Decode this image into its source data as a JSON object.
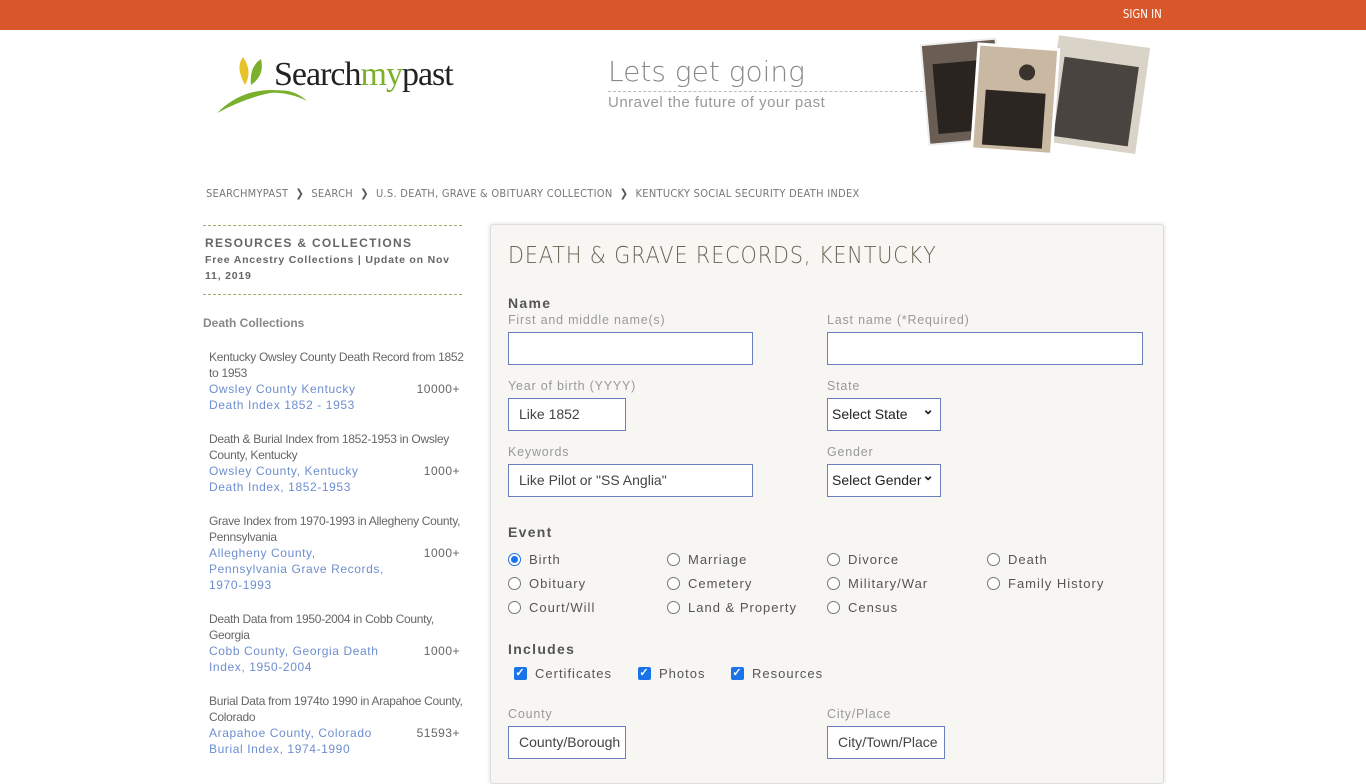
{
  "topbar": {
    "sign_in": "SIGN IN",
    "color": "#d9552a"
  },
  "header": {
    "logo_text_a": "Search",
    "logo_text_b": "my",
    "logo_text_c": "past",
    "tagline": "Lets get going",
    "subtagline": "Unravel the future of your past"
  },
  "breadcrumb": [
    "SEARCHMYPAST",
    "SEARCH",
    "U.S. DEATH, GRAVE & OBITUARY COLLECTION",
    "KENTUCKY SOCIAL SECURITY DEATH INDEX"
  ],
  "breadcrumb_sep": "❯",
  "sidebar": {
    "title": "RESOURCES & COLLECTIONS",
    "subtitle": "Free Ancestry Collections | Update on Nov 11, 2019",
    "section": "Death Collections",
    "items": [
      {
        "title": "Kentucky Owsley County Death Record from 1852 to 1953",
        "link": "Owsley County Kentucky Death Index 1852 - 1953",
        "count": "10000+"
      },
      {
        "title": "Death & Burial Index from 1852-1953 in Owsley County, Kentucky",
        "link": "Owsley County, Kentucky Death Index, 1852-1953",
        "count": "1000+"
      },
      {
        "title": "Grave Index from 1970-1993 in Allegheny County, Pennsylvania",
        "link": "Allegheny County, Pennsylvania Grave Records, 1970-1993",
        "count": "1000+"
      },
      {
        "title": "Death Data from 1950-2004 in Cobb County, Georgia",
        "link": "Cobb County, Georgia Death Index, 1950-2004",
        "count": "1000+"
      },
      {
        "title": "Burial Data from 1974to 1990 in Arapahoe County, Colorado",
        "link": "Arapahoe County, Colorado Burial Index, 1974-1990",
        "count": "51593+"
      }
    ]
  },
  "form": {
    "title": "DEATH & GRAVE RECORDS, KENTUCKY",
    "name_section": "Name",
    "first_label": "First and middle name(s)",
    "first_value": "",
    "last_label": "Last name (*Required)",
    "last_value": "",
    "year_label": "Year of birth (YYYY)",
    "year_placeholder": "Like 1852",
    "state_label": "State",
    "state_value": "Select State",
    "keywords_label": "Keywords",
    "keywords_placeholder": "Like Pilot or \"SS Anglia\"",
    "gender_label": "Gender",
    "gender_value": "Select Gender",
    "event_section": "Event",
    "events": [
      {
        "label": "Birth",
        "checked": true
      },
      {
        "label": "Marriage"
      },
      {
        "label": "Divorce"
      },
      {
        "label": "Death"
      },
      {
        "label": "Obituary"
      },
      {
        "label": "Cemetery"
      },
      {
        "label": "Military/War"
      },
      {
        "label": "Family History"
      },
      {
        "label": "Court/Will"
      },
      {
        "label": "Land & Property"
      },
      {
        "label": "Census"
      }
    ],
    "includes_section": "Includes",
    "includes": [
      {
        "label": "Certificates",
        "checked": true
      },
      {
        "label": "Photos",
        "checked": true
      },
      {
        "label": "Resources",
        "checked": true
      }
    ],
    "county_label": "County",
    "county_placeholder": "County/Borough",
    "city_label": "City/Place",
    "city_placeholder": "City/Town/Place"
  }
}
